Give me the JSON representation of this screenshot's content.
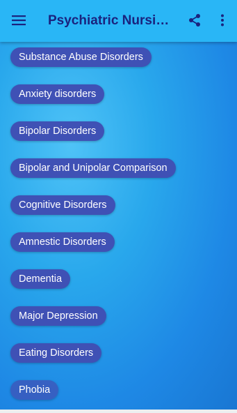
{
  "toolbar": {
    "title": "Psychiatric Nursing..."
  },
  "colors": {
    "toolbar": "#29b6f6",
    "title": "#1a237e",
    "chip": "#3f51b5",
    "background": "#29a8ec"
  },
  "icons": {
    "menu": "hamburger-menu-icon",
    "share": "share-icon",
    "more": "more-vert-icon"
  },
  "topics": [
    "Substance Abuse Disorders",
    "Anxiety disorders",
    "Bipolar Disorders",
    "Bipolar and Unipolar Comparison",
    "Cognitive Disorders",
    "Amnestic Disorders",
    "Dementia",
    "Major Depression",
    "Eating Disorders",
    "Phobia"
  ]
}
